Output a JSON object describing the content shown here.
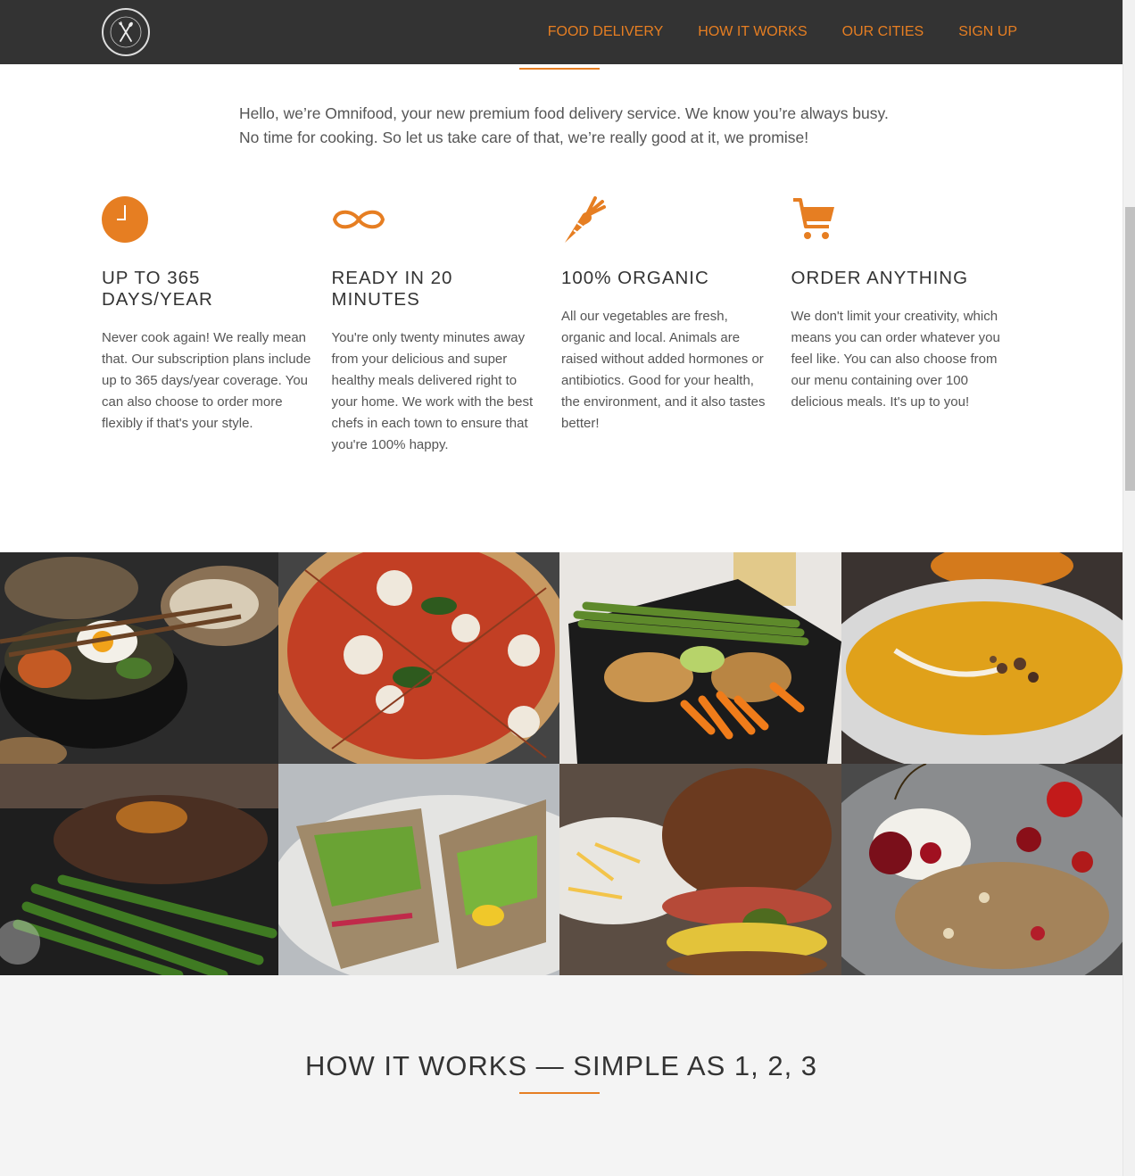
{
  "nav": {
    "logo_alt": "Omnifood",
    "links": [
      "FOOD DELIVERY",
      "HOW IT WORKS",
      "OUR CITIES",
      "SIGN UP"
    ]
  },
  "intro": {
    "line1": "Hello, we’re Omnifood, your new premium food delivery service. We know you’re always busy.",
    "line2": "No time for cooking. So let us take care of that, we’re really good at it, we promise!"
  },
  "features": [
    {
      "icon": "clock-icon",
      "title": "Up to 365 days/year",
      "text": "Never cook again! We really mean that. Our subscription plans include up to 365 days/year coverage. You can also choose to order more flexibly if that's your style."
    },
    {
      "icon": "infinity-icon",
      "title": "Ready in 20 minutes",
      "text": "You're only twenty minutes away from your delicious and super healthy meals delivered right to your home. We work with the best chefs in each town to ensure that you're 100% happy."
    },
    {
      "icon": "carrot-icon",
      "title": "100% organic",
      "text": "All our vegetables are fresh, organic and local. Animals are raised without added hormones or antibiotics. Good for your health, the environment, and it also tastes better!"
    },
    {
      "icon": "cart-icon",
      "title": "Order anything",
      "text": "We don't limit your creativity, which means you can order whatever you feel like. You can also choose from our menu containing over 100 delicious meals. It's up to you!"
    }
  ],
  "accent_color": "#e67e22",
  "meals": [
    "bibimbap",
    "pizza",
    "chicken-asparagus",
    "pumpkin-soup",
    "steak-green-beans",
    "pita-sandwich",
    "burger",
    "granola-cherries"
  ],
  "how": {
    "title": "How it works — Simple as 1, 2, 3"
  }
}
